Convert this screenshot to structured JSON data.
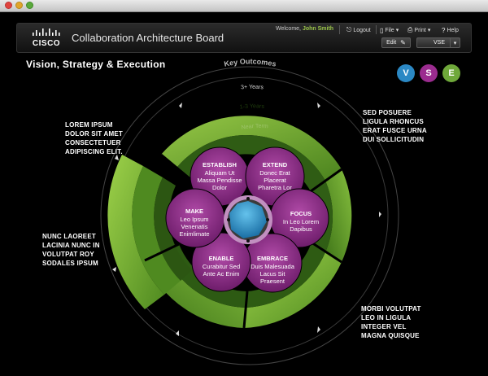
{
  "window": {
    "traffic_lights": [
      "close",
      "minimize",
      "zoom"
    ]
  },
  "header": {
    "logo_text": "CISCO",
    "app_title": "Collaboration Architecture Board",
    "welcome_prefix": "Welcome,",
    "user_name": "John Smith",
    "logout_label": "Logout",
    "file_label": "File",
    "print_label": "Print",
    "help_label": "Help",
    "edit_label": "Edit",
    "view_select_value": "VSE"
  },
  "page": {
    "heading": "Vision, Strategy & Execution",
    "badges": [
      {
        "letter": "V",
        "color": "#2b88c4"
      },
      {
        "letter": "S",
        "color": "#9b2c8f"
      },
      {
        "letter": "E",
        "color": "#6fa83a"
      }
    ]
  },
  "diagram": {
    "ring_labels": {
      "outer": "Key Outcomes",
      "middle": "3+ Years",
      "inner": "1-3 Years",
      "innermost": "Near Term"
    },
    "petals": [
      {
        "title": "ESTABLISH",
        "lines": [
          "Aliquam Ut",
          "Massa Pendisse",
          "Dolor"
        ]
      },
      {
        "title": "EXTEND",
        "lines": [
          "Donec Erat",
          "Placerat",
          "Pharetra Lor"
        ]
      },
      {
        "title": "FOCUS",
        "lines": [
          "In Leo Lorem",
          "Dapibus"
        ]
      },
      {
        "title": "EMBRACE",
        "lines": [
          "Duis Malesuada",
          "Lacus Sit",
          "Praesent"
        ]
      },
      {
        "title": "ENABLE",
        "lines": [
          "Curabitur Sed",
          "Ante Ac Enim"
        ]
      },
      {
        "title": "MAKE",
        "lines": [
          "Leo Ipsum",
          "Venenatis",
          "Enimlimate"
        ]
      }
    ]
  },
  "corners": {
    "top_left": [
      "LOREM IPSUM",
      "DOLOR SIT AMET",
      "CONSECTETUER",
      "ADIPISCING ELIT."
    ],
    "top_right": [
      "SED POSUERE",
      "LIGULA RHONCUS",
      "ERAT FUSCE URNA",
      "DUI SOLLICITUDIN"
    ],
    "mid_left": [
      "NUNC LAOREET",
      "LACINIA NUNC IN",
      "VOLUTPAT ROY",
      "SODALES IPSUM"
    ],
    "bottom_right": [
      "MORBI VOLUTPAT",
      "LEO IN LIGULA",
      "INTEGER VEL",
      "MAGNA QUISQUE"
    ]
  },
  "colors": {
    "green_ring": "#6aa234",
    "purple_petal": "#8d2f86",
    "center_blue": "#2c86b8"
  }
}
